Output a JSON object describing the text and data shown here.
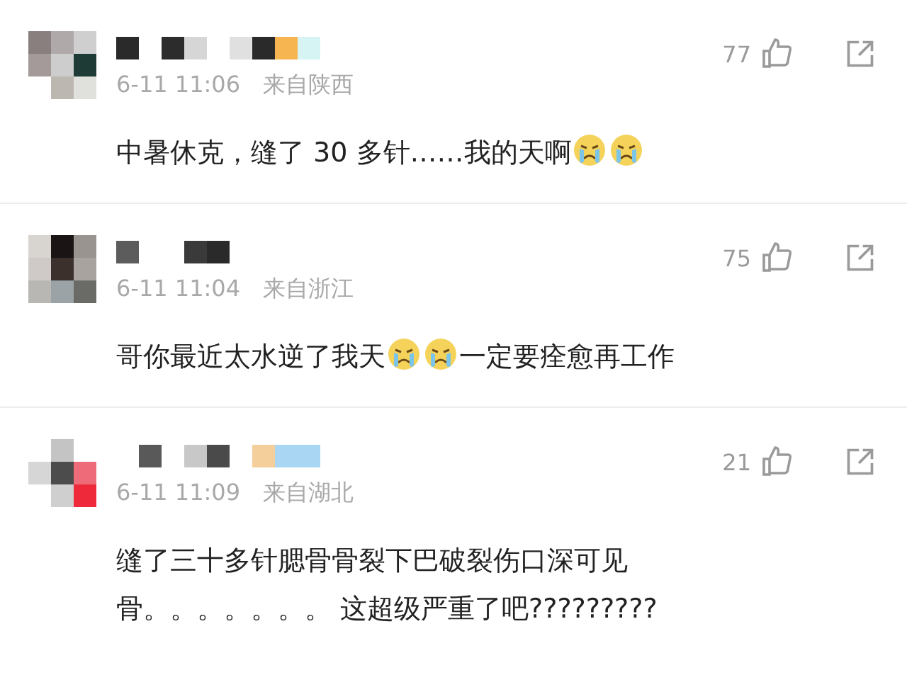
{
  "comments": [
    {
      "time": "6-11 11:06",
      "location": "来自陕西",
      "likes": "77",
      "content": [
        {
          "kind": "text",
          "text": "中暑休克，缝了 30 多针……我的天啊"
        },
        {
          "kind": "emoji"
        },
        {
          "kind": "emoji"
        }
      ]
    },
    {
      "time": "6-11 11:04",
      "location": "来自浙江",
      "likes": "75",
      "content": [
        {
          "kind": "text",
          "text": "哥你最近太水逆了我天"
        },
        {
          "kind": "emoji"
        },
        {
          "kind": "emoji"
        },
        {
          "kind": "text",
          "text": "一定要痊愈再工作"
        }
      ]
    },
    {
      "time": "6-11 11:09",
      "location": "来自湖北",
      "likes": "21",
      "content": [
        {
          "kind": "text",
          "text": "缝了三十多针腮骨骨裂下巴破裂伤口深可见骨。。。。。。。 这超级严重了吧?????????"
        }
      ]
    }
  ]
}
